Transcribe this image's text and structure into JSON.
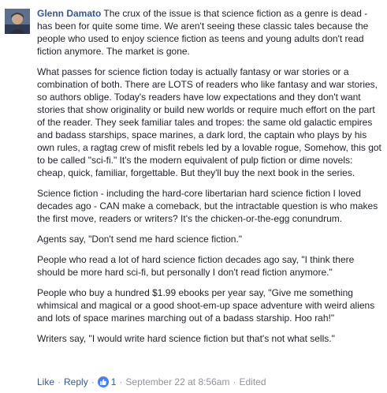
{
  "comment": {
    "author": "Glenn Damato",
    "paragraphs": [
      "The crux of the issue is that science fiction as a genre is dead - has been for quite some time. We aren't seeing these classic tales because the people who used to enjoy science fiction as teens and young adults don't read fiction anymore. The market is gone.",
      "What passes for science fiction today is actually fantasy or war stories or a combination of both. There are LOTS of readers who like fantasy and war stories, so authors oblige. Today's readers have low expectations and they don't want stories that show originality or build new worlds or require much effort on the part of the reader. They seek familiar tales and tropes: the same old galactic empires and badass starships, space marines, a dark lord, the captain who plays by his own rules, a ragtag crew of misfit rebels led by a lovable rogue, Somehow, this got to be called \"sci-fi.\" It's the modern equivalent of pulp fiction or dime novels: cheap, quick, familiar, forgettable. But they'll buy the next book in the series.",
      "Science fiction - including the hard-core libertarian hard science fiction I loved decades ago - CAN make a comeback, but the intractable question is who makes the first move, readers or writers? It's the chicken-or-the-egg conundrum.",
      "Agents say, \"Don't send me hard science fiction.\"",
      "People who read a lot of hard science fiction decades ago say, \"I think there should be more hard sci-fi, but personally I don't read fiction anymore.\"",
      "People who buy a hundred $1.99 ebooks per year say, \"Give me something whimsical and magical or a good shoot-em-up space adventure with weird aliens and lots of space marines marching out of a badass starship. Hoo rah!\"",
      "Writers say, \"I would write hard science fiction but that's not what sells.\""
    ]
  },
  "actions": {
    "like_label": "Like",
    "reply_label": "Reply",
    "separator": "·",
    "reaction_count": "1",
    "timestamp": "September 22 at 8:56am",
    "edited_label": "Edited",
    "like_badge_icon": "thumbs-up-icon",
    "link_color": "#365899",
    "badge_color": "#4080ff"
  }
}
